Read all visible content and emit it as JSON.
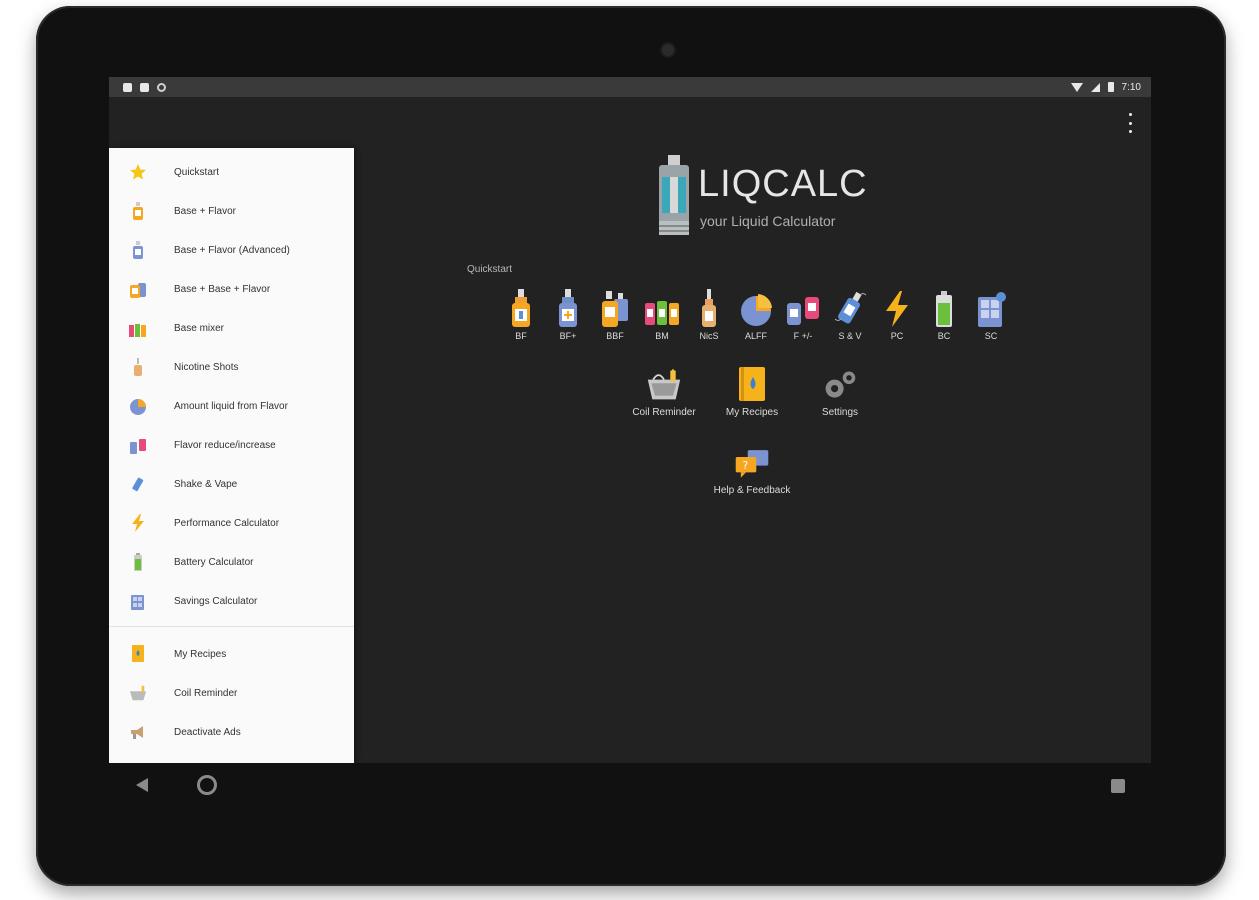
{
  "status_bar": {
    "time": "7:10"
  },
  "app": {
    "title": "LIQCALC",
    "subtitle": "your Liquid Calculator"
  },
  "drawer": {
    "items": [
      {
        "label": "Quickstart",
        "icon": "star-icon"
      },
      {
        "label": "Base + Flavor",
        "icon": "bottle-orange-icon"
      },
      {
        "label": "Base + Flavor (Advanced)",
        "icon": "bottle-blue-icon"
      },
      {
        "label": "Base + Base + Flavor",
        "icon": "two-bottles-icon"
      },
      {
        "label": "Base mixer",
        "icon": "bottles-row-icon"
      },
      {
        "label": "Nicotine Shots",
        "icon": "dropper-bottle-icon"
      },
      {
        "label": "Amount liquid from Flavor",
        "icon": "pie-chart-icon"
      },
      {
        "label": "Flavor reduce/increase",
        "icon": "bottles-arrows-icon"
      },
      {
        "label": "Shake & Vape",
        "icon": "shake-bottle-icon"
      },
      {
        "label": "Performance Calculator",
        "icon": "lightning-icon"
      },
      {
        "label": "Battery Calculator",
        "icon": "battery-icon"
      },
      {
        "label": "Savings Calculator",
        "icon": "calculator-icon"
      }
    ],
    "secondary": [
      {
        "label": "My Recipes",
        "icon": "recipe-book-icon"
      },
      {
        "label": "Coil Reminder",
        "icon": "coil-basket-icon"
      },
      {
        "label": "Deactivate Ads",
        "icon": "megaphone-icon"
      }
    ]
  },
  "quickstart": {
    "label": "Quickstart",
    "items": [
      {
        "label": "BF",
        "icon": "bottle-orange-icon"
      },
      {
        "label": "BF+",
        "icon": "bottle-blue-icon"
      },
      {
        "label": "BBF",
        "icon": "two-bottles-icon"
      },
      {
        "label": "BM",
        "icon": "bottles-row-icon"
      },
      {
        "label": "NicS",
        "icon": "dropper-bottle-icon"
      },
      {
        "label": "ALFF",
        "icon": "pie-chart-icon"
      },
      {
        "label": "F +/-",
        "icon": "bottles-arrows-icon"
      },
      {
        "label": "S & V",
        "icon": "shake-bottle-icon"
      },
      {
        "label": "PC",
        "icon": "lightning-icon"
      },
      {
        "label": "BC",
        "icon": "battery-icon"
      },
      {
        "label": "SC",
        "icon": "calculator-icon"
      }
    ]
  },
  "main_actions": [
    {
      "label": "Coil Reminder",
      "icon": "coil-basket-icon"
    },
    {
      "label": "My Recipes",
      "icon": "recipe-book-icon"
    },
    {
      "label": "Settings",
      "icon": "gears-icon"
    },
    {
      "label": "Help & Feedback",
      "icon": "chat-help-icon"
    }
  ],
  "colors": {
    "background": "#222222",
    "drawer": "#fafafa",
    "accent_orange": "#f5a623",
    "accent_blue": "#5b8fd6",
    "accent_green": "#6bbf3a"
  }
}
